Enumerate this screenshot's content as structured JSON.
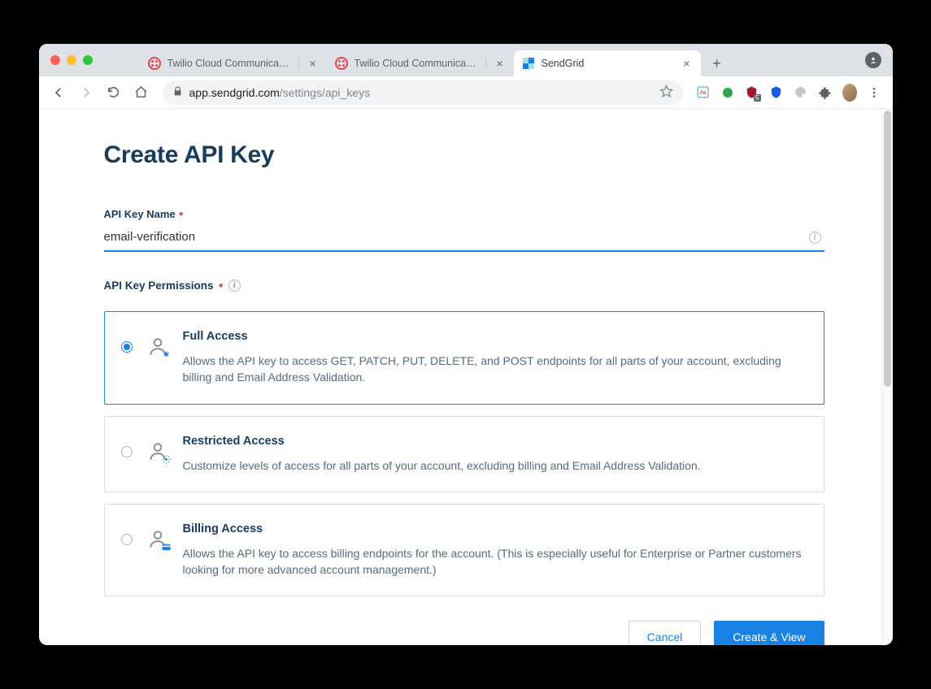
{
  "tabs": [
    {
      "favicon": "twilio",
      "title": "Twilio Cloud Communications"
    },
    {
      "favicon": "twilio",
      "title": "Twilio Cloud Communications"
    },
    {
      "favicon": "sendgrid",
      "title": "SendGrid"
    }
  ],
  "activeTab": 2,
  "address": {
    "host": "app.sendgrid.com",
    "path": "/settings/api_keys"
  },
  "page": {
    "heading": "Create API Key",
    "name_label": "API Key Name",
    "name_value": "email-verification",
    "permissions_label": "API Key Permissions",
    "options": [
      {
        "key": "full",
        "title": "Full Access",
        "desc": "Allows the API key to access GET, PATCH, PUT, DELETE, and POST endpoints for all parts of your account, excluding billing and Email Address Validation.",
        "selected": true,
        "badge": "star"
      },
      {
        "key": "restricted",
        "title": "Restricted Access",
        "desc": "Customize levels of access for all parts of your account, excluding billing and Email Address Validation.",
        "selected": false,
        "badge": "gear"
      },
      {
        "key": "billing",
        "title": "Billing Access",
        "desc": "Allows the API key to access billing endpoints for the account. (This is especially useful for Enterprise or Partner customers looking for more advanced account management.)",
        "selected": false,
        "badge": "card"
      }
    ],
    "cancel_label": "Cancel",
    "submit_label": "Create & View"
  }
}
